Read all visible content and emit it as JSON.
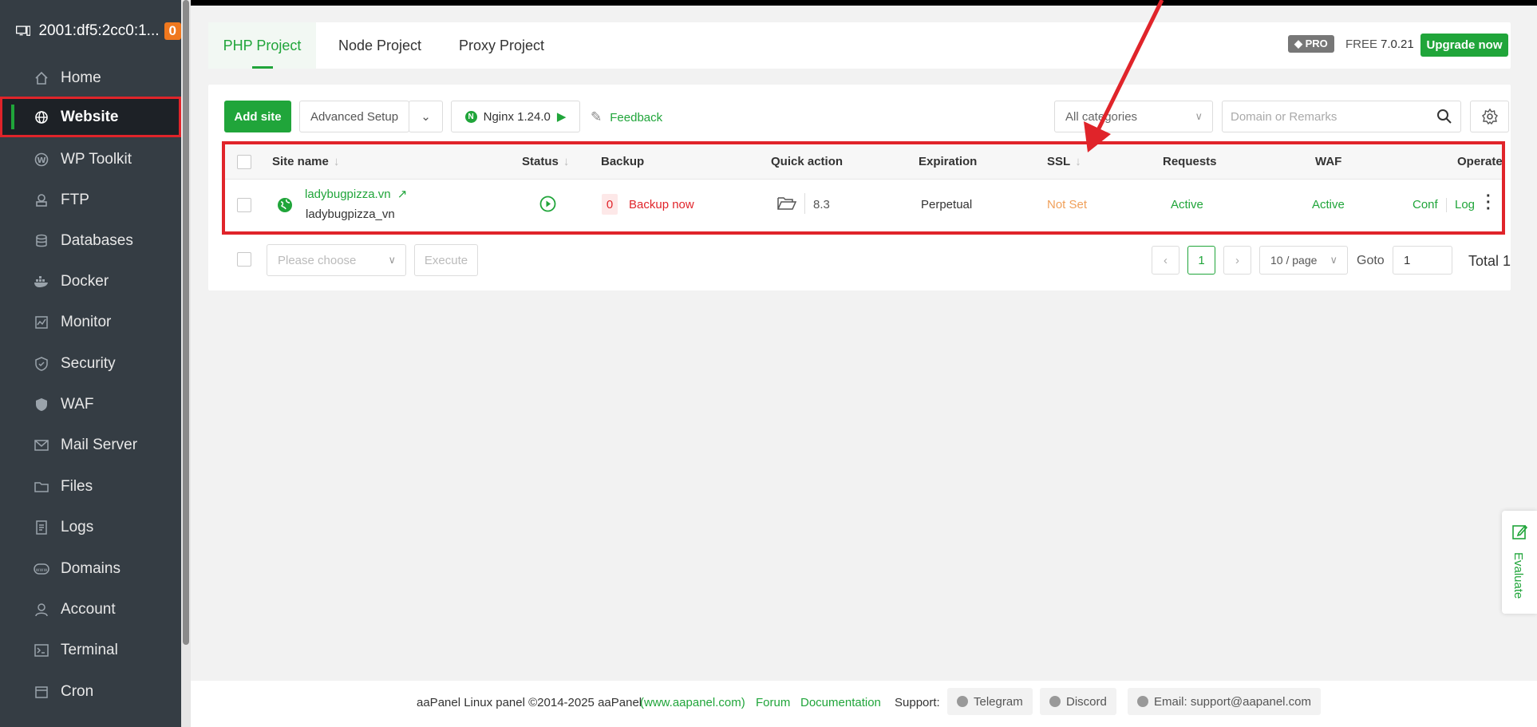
{
  "sidebar": {
    "host": "2001:df5:2cc0:1...",
    "badge": "0",
    "items": [
      {
        "label": "Home",
        "icon": "home-icon"
      },
      {
        "label": "Website",
        "icon": "globe-icon"
      },
      {
        "label": "WP Toolkit",
        "icon": "wordpress-icon"
      },
      {
        "label": "FTP",
        "icon": "ftp-icon"
      },
      {
        "label": "Databases",
        "icon": "database-icon"
      },
      {
        "label": "Docker",
        "icon": "docker-icon"
      },
      {
        "label": "Monitor",
        "icon": "monitor-icon"
      },
      {
        "label": "Security",
        "icon": "shield-icon"
      },
      {
        "label": "WAF",
        "icon": "waf-shield-icon"
      },
      {
        "label": "Mail Server",
        "icon": "mail-icon"
      },
      {
        "label": "Files",
        "icon": "folder-icon"
      },
      {
        "label": "Logs",
        "icon": "logs-icon"
      },
      {
        "label": "Domains",
        "icon": "www-icon"
      },
      {
        "label": "Account",
        "icon": "user-icon"
      },
      {
        "label": "Terminal",
        "icon": "terminal-icon"
      },
      {
        "label": "Cron",
        "icon": "calendar-icon"
      }
    ]
  },
  "tabs": [
    "PHP Project",
    "Node Project",
    "Proxy Project"
  ],
  "header": {
    "pro": "PRO",
    "free": "FREE",
    "version": "7.0.21",
    "upgrade": "Upgrade now"
  },
  "toolbar": {
    "add_site": "Add site",
    "advanced": "Advanced Setup",
    "nginx": "Nginx 1.24.0",
    "feedback": "Feedback",
    "category": "All categories",
    "search_placeholder": "Domain or Remarks"
  },
  "table": {
    "headers": [
      "Site name",
      "Status",
      "Backup",
      "Quick action",
      "Expiration",
      "SSL",
      "Requests",
      "WAF",
      "Operate"
    ],
    "rows": [
      {
        "site": "ladybugpizza.vn",
        "remark": "ladybugpizza_vn",
        "backup_count": "0",
        "backup_action": "Backup now",
        "php": "8.3",
        "expiration": "Perpetual",
        "ssl": "Not Set",
        "requests": "Active",
        "waf": "Active",
        "conf": "Conf",
        "log": "Log"
      }
    ]
  },
  "bulk": {
    "placeholder": "Please choose",
    "execute": "Execute"
  },
  "pager": {
    "current": "1",
    "per_page": "10 / page",
    "goto_label": "Goto",
    "goto_value": "1",
    "total": "Total 1"
  },
  "footer": {
    "copyright": "aaPanel Linux panel ©2014-2025 aaPanel",
    "site": "(www.aapanel.com)",
    "forum": "Forum",
    "docs": "Documentation",
    "support": "Support:",
    "telegram": "Telegram",
    "discord": "Discord",
    "email": "Email: support@aapanel.com"
  },
  "evaluate": "Evaluate",
  "colors": {
    "accent": "#20a53a",
    "sidebar": "#353d44",
    "highlight": "#e0242a"
  }
}
